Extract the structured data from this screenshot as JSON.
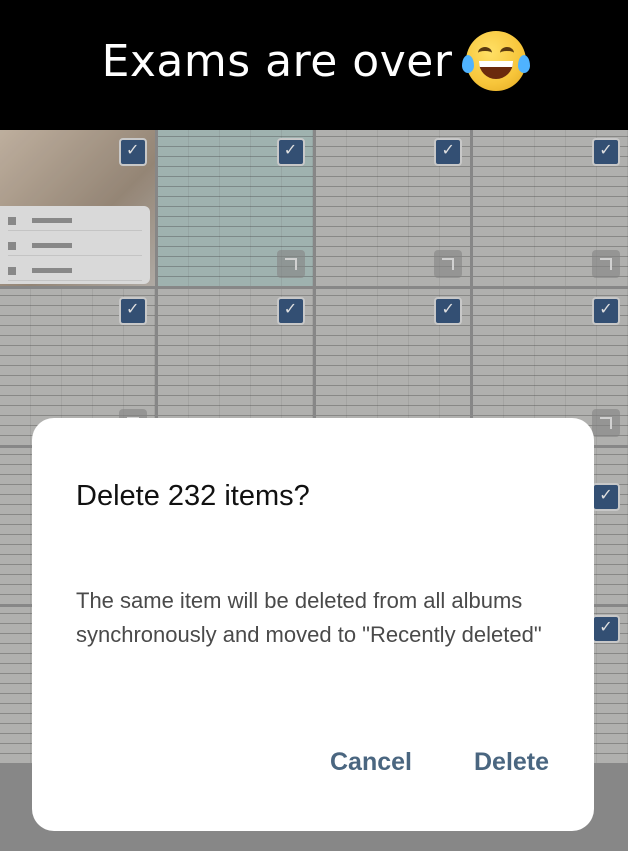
{
  "caption": {
    "text": "Exams are over",
    "emoji": "face-with-tears-of-joy"
  },
  "gallery": {
    "check_icon": "checkmark",
    "tiles": 16
  },
  "dialog": {
    "title": "Delete 232 items?",
    "message": "The same item will be deleted from all albums synchronously and moved to \"Recently deleted\"",
    "cancel_label": "Cancel",
    "delete_label": "Delete"
  },
  "colors": {
    "accent": "#4a6680",
    "check": "#3b5a83"
  }
}
